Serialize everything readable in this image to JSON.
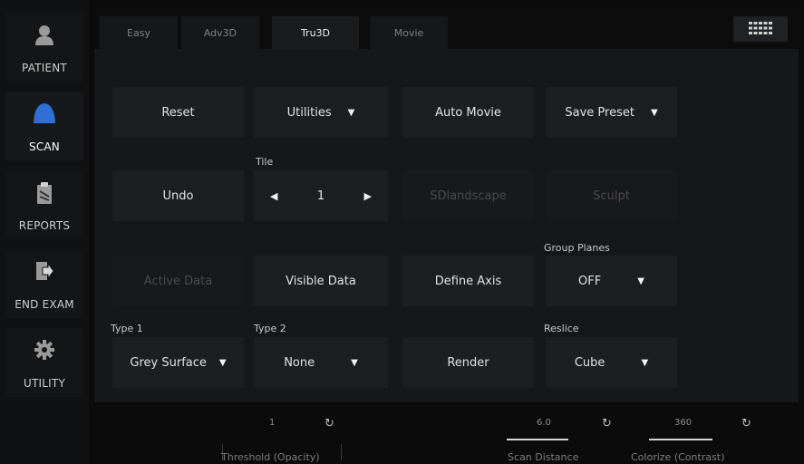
{
  "sidebar": {
    "items": [
      {
        "label": "PATIENT",
        "icon": "person-icon"
      },
      {
        "label": "SCAN",
        "icon": "probe-icon"
      },
      {
        "label": "REPORTS",
        "icon": "clipboard-icon"
      },
      {
        "label": "END EXAM",
        "icon": "exit-icon"
      },
      {
        "label": "UTILITY",
        "icon": "gear-icon"
      }
    ],
    "active": "SCAN",
    "accent_color": "#2f6fd6"
  },
  "tabs": [
    {
      "label": "Easy"
    },
    {
      "label": "Adv3D"
    },
    {
      "label": "Tru3D"
    },
    {
      "label": "Movie"
    }
  ],
  "active_tab": "Tru3D",
  "controls": {
    "reset": "Reset",
    "utilities": "Utilities",
    "auto_movie": "Auto Movie",
    "save_preset": "Save Preset",
    "undo": "Undo",
    "tile_label": "Tile",
    "tile_value": "1",
    "sdlandscape": "SDlandscape",
    "sculpt": "Sculpt",
    "group_planes_label": "Group Planes",
    "active_data": "Active Data",
    "visible_data": "Visible Data",
    "define_axis": "Define Axis",
    "group_planes_value": "OFF",
    "type1_label": "Type 1",
    "type1_value": "Grey Surface",
    "type2_label": "Type 2",
    "type2_value": "None",
    "render": "Render",
    "reslice_label": "Reslice",
    "reslice_value": "Cube"
  },
  "knobs": [
    {
      "label": "Threshold (Opacity)",
      "value": "1"
    },
    {
      "label": "Scan Distance",
      "value": "6.0"
    },
    {
      "label": "Colorize (Contrast)",
      "value": "360"
    }
  ]
}
